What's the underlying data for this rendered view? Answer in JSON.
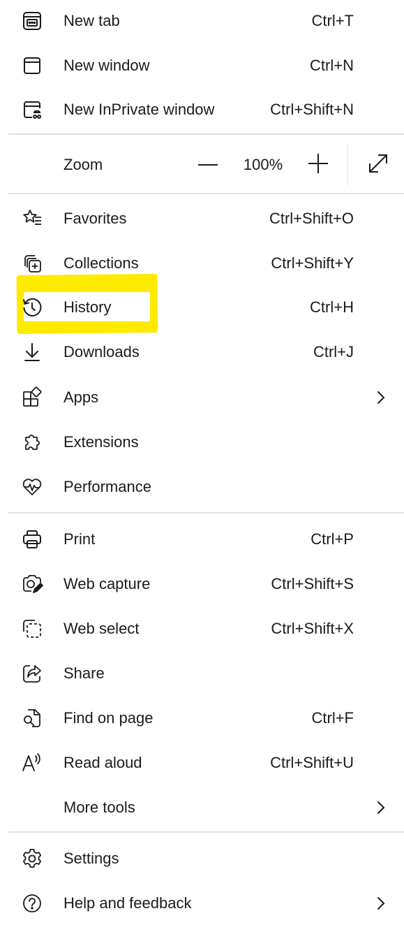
{
  "menu": {
    "new_tab": {
      "label": "New tab",
      "shortcut": "Ctrl+T"
    },
    "new_window": {
      "label": "New window",
      "shortcut": "Ctrl+N"
    },
    "new_inprivate": {
      "label": "New InPrivate window",
      "shortcut": "Ctrl+Shift+N"
    },
    "zoom": {
      "label": "Zoom",
      "value": "100%"
    },
    "favorites": {
      "label": "Favorites",
      "shortcut": "Ctrl+Shift+O"
    },
    "collections": {
      "label": "Collections",
      "shortcut": "Ctrl+Shift+Y"
    },
    "history": {
      "label": "History",
      "shortcut": "Ctrl+H"
    },
    "downloads": {
      "label": "Downloads",
      "shortcut": "Ctrl+J"
    },
    "apps": {
      "label": "Apps"
    },
    "extensions": {
      "label": "Extensions"
    },
    "performance": {
      "label": "Performance"
    },
    "print": {
      "label": "Print",
      "shortcut": "Ctrl+P"
    },
    "web_capture": {
      "label": "Web capture",
      "shortcut": "Ctrl+Shift+S"
    },
    "web_select": {
      "label": "Web select",
      "shortcut": "Ctrl+Shift+X"
    },
    "share": {
      "label": "Share"
    },
    "find_on_page": {
      "label": "Find on page",
      "shortcut": "Ctrl+F"
    },
    "read_aloud": {
      "label": "Read aloud",
      "shortcut": "Ctrl+Shift+U"
    },
    "more_tools": {
      "label": "More tools"
    },
    "settings": {
      "label": "Settings"
    },
    "help": {
      "label": "Help and feedback"
    }
  },
  "icons": {
    "new_tab": "new-tab-icon",
    "new_window": "window-icon",
    "new_inprivate": "inprivate-window-icon",
    "zoom_out": "minus-icon",
    "zoom_in": "plus-icon",
    "fullscreen": "expand-diagonal-icon",
    "favorites": "star-list-icon",
    "collections": "collections-icon",
    "history": "history-clock-icon",
    "downloads": "download-arrow-icon",
    "apps": "apps-grid-icon",
    "extensions": "puzzle-piece-icon",
    "performance": "heart-pulse-icon",
    "print": "printer-icon",
    "web_capture": "camera-pen-icon",
    "web_select": "dashed-select-icon",
    "share": "share-arrow-icon",
    "find_on_page": "page-search-icon",
    "read_aloud": "read-aloud-icon",
    "settings": "gear-icon",
    "help": "question-circle-icon",
    "submenu": "chevron-right-icon"
  },
  "colors": {
    "text": "#1b1b1b",
    "divider": "#e1e1e1",
    "highlight": "#ffeb00",
    "background": "#ffffff"
  }
}
